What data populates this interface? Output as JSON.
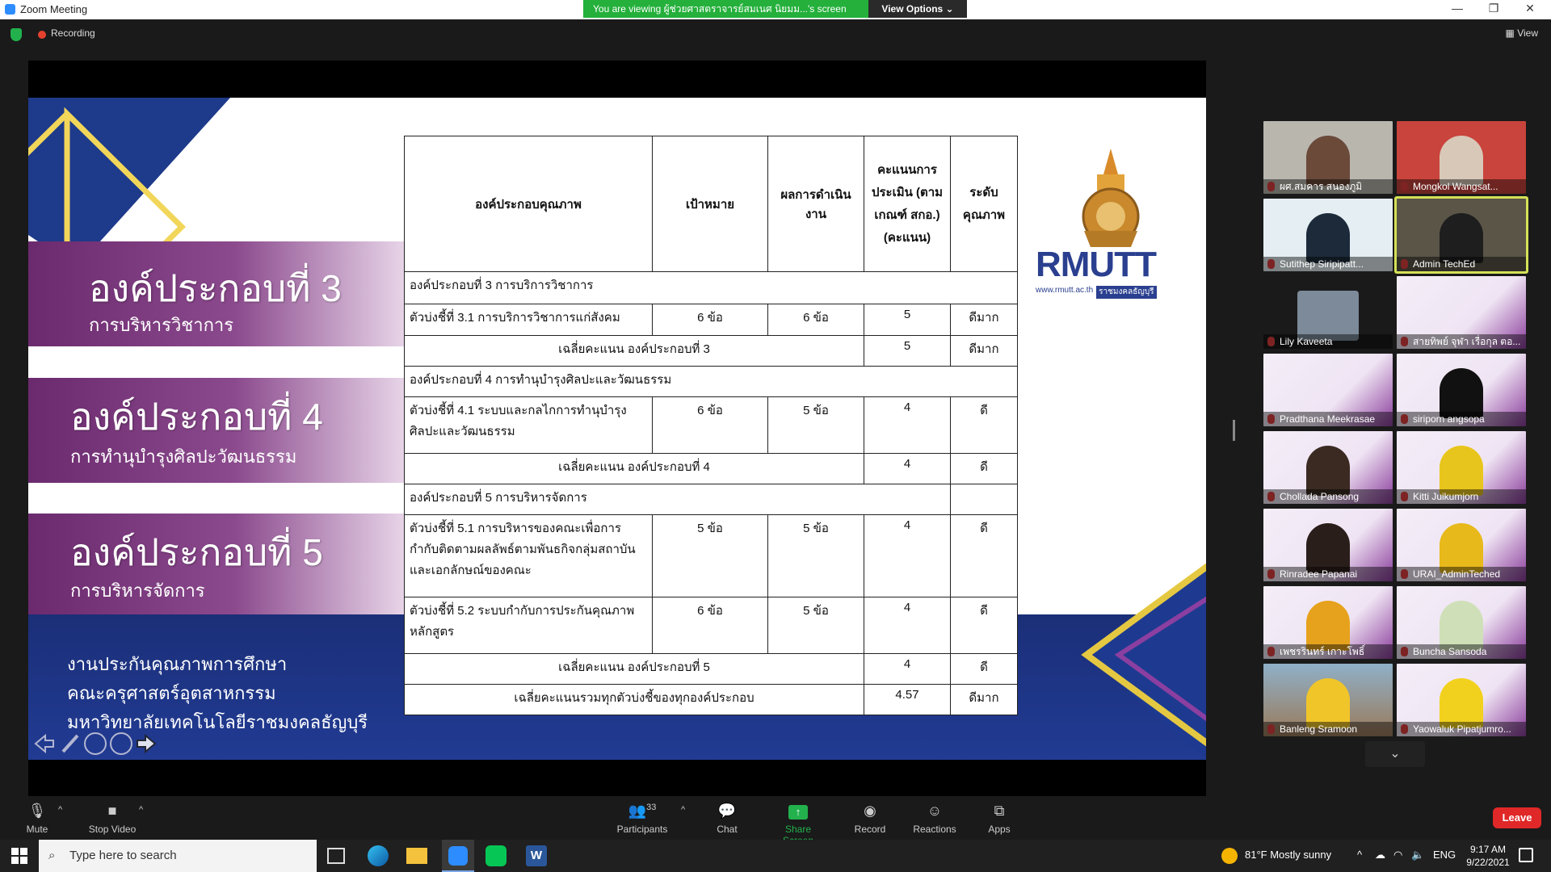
{
  "window": {
    "title": "Zoom Meeting"
  },
  "banner": {
    "message": "You are viewing ผู้ช่วยศาสตราจารย์สมเนศ นิยมม...'s screen",
    "view_options": "View Options"
  },
  "recording": {
    "label": "Recording"
  },
  "view_label": "View",
  "slide": {
    "sections": [
      {
        "big": "องค์ประกอบที่ 3",
        "small": "การบริหารวิชาการ"
      },
      {
        "big": "องค์ประกอบที่ 4",
        "small": "การทำนุบำรุงศิลปะวัฒนธรรม"
      },
      {
        "big": "องค์ประกอบที่ 5",
        "small": "การบริหารจัดการ"
      }
    ],
    "dept": [
      "งานประกันคุณภาพการศึกษา",
      "คณะครุศาสตร์อุตสาหกรรม",
      "มหาวิทยาลัยเทคโนโลยีราชมงคลธัญบุรี"
    ],
    "logo": {
      "name": "RMUTT",
      "url": "www.rmutt.ac.th",
      "sub": "ราชมงคลธัญบุรี"
    },
    "table": {
      "headers": [
        "องค์ประกอบคุณภาพ",
        "เป้าหมาย",
        "ผลการดำเนินงาน",
        "คะแนนการประเมิน (ตามเกณฑ์ สกอ.) (คะแนน)",
        "ระดับคุณภาพ"
      ],
      "c3": "องค์ประกอบที่ 3 การบริการวิชาการ",
      "r31": [
        "ตัวบ่งชี้ที่ 3.1 การบริการวิชาการแก่สังคม",
        "6 ข้อ",
        "6 ข้อ",
        "5",
        "ดีมาก"
      ],
      "avg3": [
        "เฉลี่ยคะแนน องค์ประกอบที่ 3",
        "5",
        "ดีมาก"
      ],
      "c4": "องค์ประกอบที่ 4 การทำนุบำรุงศิลปะและวัฒนธรรม",
      "r41": [
        "ตัวบ่งชี้ที่ 4.1 ระบบและกลไกการทำนุบำรุงศิลปะและวัฒนธรรม",
        "6 ข้อ",
        "5 ข้อ",
        "4",
        "ดี"
      ],
      "avg4": [
        "เฉลี่ยคะแนน องค์ประกอบที่ 4",
        "4",
        "ดี"
      ],
      "c5": "องค์ประกอบที่ 5 การบริหารจัดการ",
      "r51": [
        "ตัวบ่งชี้ที่ 5.1 การบริหารของคณะเพื่อการกำกับติดตามผลลัพธ์ตามพันธกิจกลุ่มสถาบัน และเอกลักษณ์ของคณะ",
        "5 ข้อ",
        "5 ข้อ",
        "4",
        "ดี"
      ],
      "r52": [
        "ตัวบ่งชี้ที่ 5.2 ระบบกำกับการประกันคุณภาพหลักสูตร",
        "6 ข้อ",
        "5 ข้อ",
        "4",
        "ดี"
      ],
      "avg5": [
        "เฉลี่ยคะแนน องค์ประกอบที่ 5",
        "4",
        "ดี"
      ],
      "total": [
        "เฉลี่ยคะแนนรวมทุกตัวบ่งชี้ของทุกองค์ประกอบ",
        "4.57",
        "ดีมาก"
      ]
    }
  },
  "participants": [
    {
      "name": "ผศ.สมคาร สนองภูมิ"
    },
    {
      "name": "Mongkol Wangsat..."
    },
    {
      "name": "Sutithep Siripipatt..."
    },
    {
      "name": "Admin TechEd"
    },
    {
      "name": "Lily Kaveeta"
    },
    {
      "name": "สายทิพย์ จุฬา เรื่อกุล ตอ..."
    },
    {
      "name": "Pradthana Meekrasae"
    },
    {
      "name": "siriporn angsopa"
    },
    {
      "name": "Chollada Pansong"
    },
    {
      "name": "Kitti Juikumjorn"
    },
    {
      "name": "Rinradee Papanai"
    },
    {
      "name": "URAI_AdminTeched"
    },
    {
      "name": "เพชรรินทร์ เกาะโพธิ์"
    },
    {
      "name": "Buncha Sansoda"
    },
    {
      "name": "Banleng Sramoon"
    },
    {
      "name": "Yaowaluk Pipatjumro..."
    }
  ],
  "toolbar": {
    "mute": "Mute",
    "stop_video": "Stop Video",
    "participants": "Participants",
    "participant_count": "33",
    "chat": "Chat",
    "share_screen": "Share Screen",
    "record": "Record",
    "reactions": "Reactions",
    "apps": "Apps",
    "leave": "Leave"
  },
  "taskbar": {
    "search_placeholder": "Type here to search",
    "weather": "81°F  Mostly sunny",
    "lang": "ENG",
    "time": "9:17 AM",
    "date": "9/22/2021"
  },
  "colors": {
    "banner_green": "#24b03b",
    "leave_red": "#e02828",
    "share_green": "#23b14d",
    "slide_purple": "#6b2a6e",
    "slide_blue": "#1b2f78"
  }
}
